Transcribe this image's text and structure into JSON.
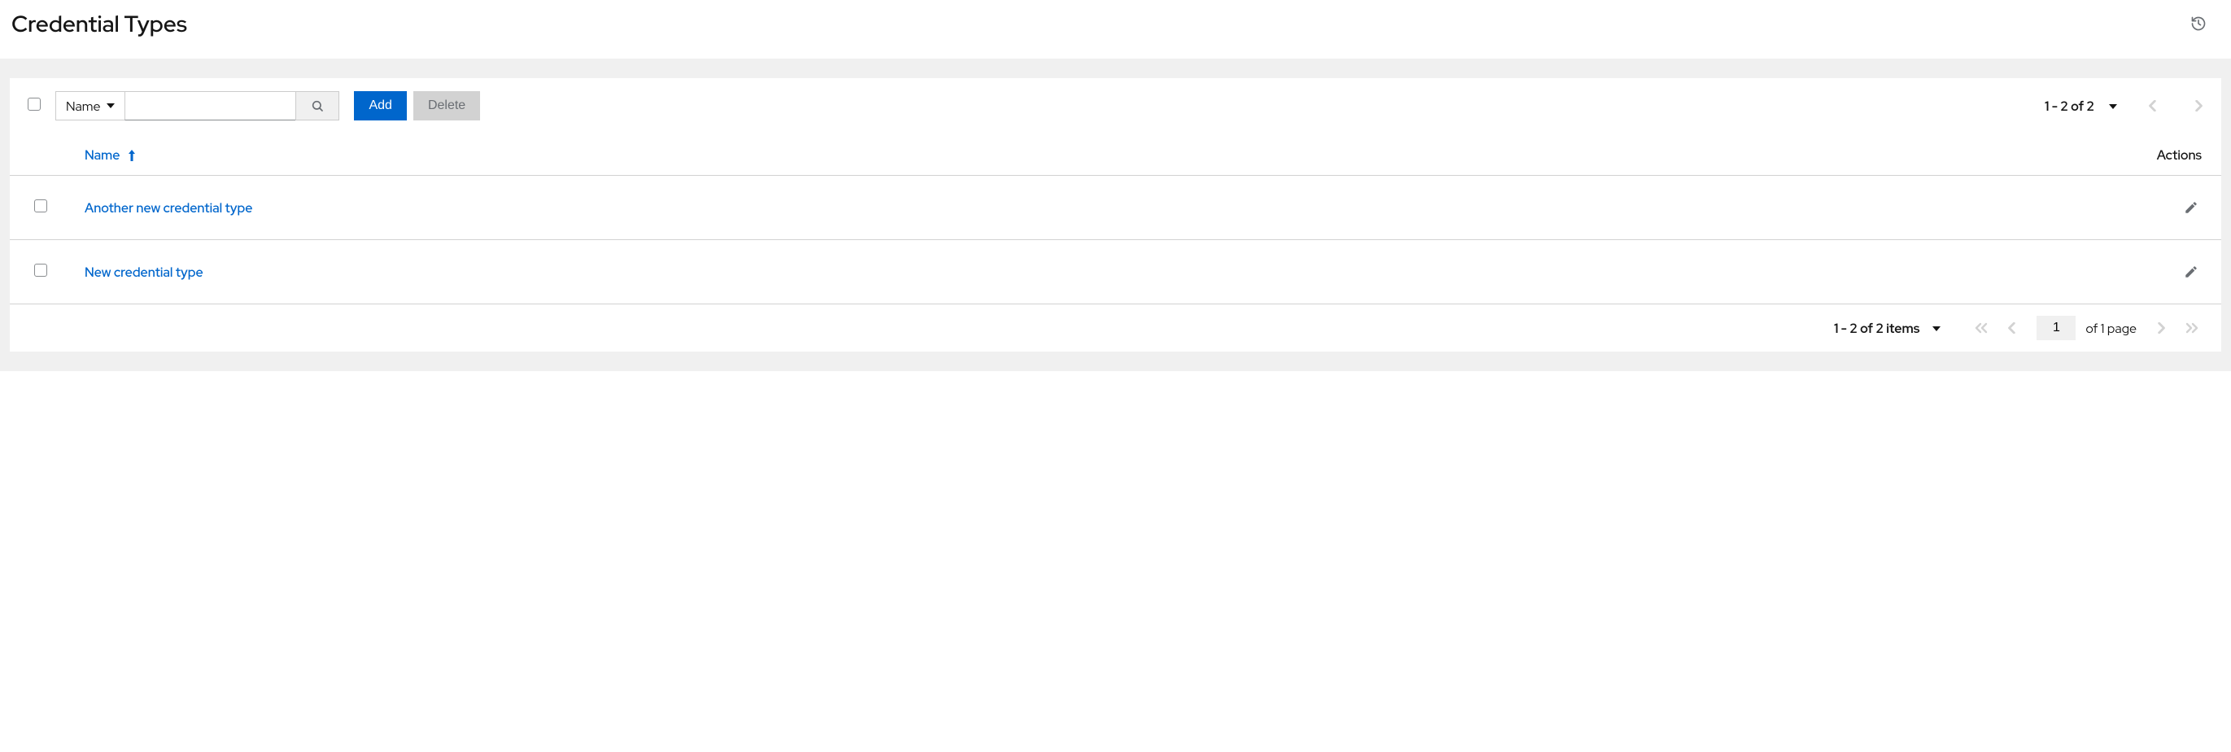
{
  "header": {
    "title": "Credential Types"
  },
  "toolbar": {
    "filter_field_label": "Name",
    "search_value": "",
    "add_label": "Add",
    "delete_label": "Delete",
    "top_pager_text": "1 - 2 of 2"
  },
  "table": {
    "columns": {
      "name": "Name",
      "actions": "Actions"
    },
    "rows": [
      {
        "name": "Another new credential type"
      },
      {
        "name": "New credential type"
      }
    ]
  },
  "footer": {
    "items_text": "1 - 2 of 2 items",
    "page_value": "1",
    "of_pages_text": "of 1 page"
  }
}
